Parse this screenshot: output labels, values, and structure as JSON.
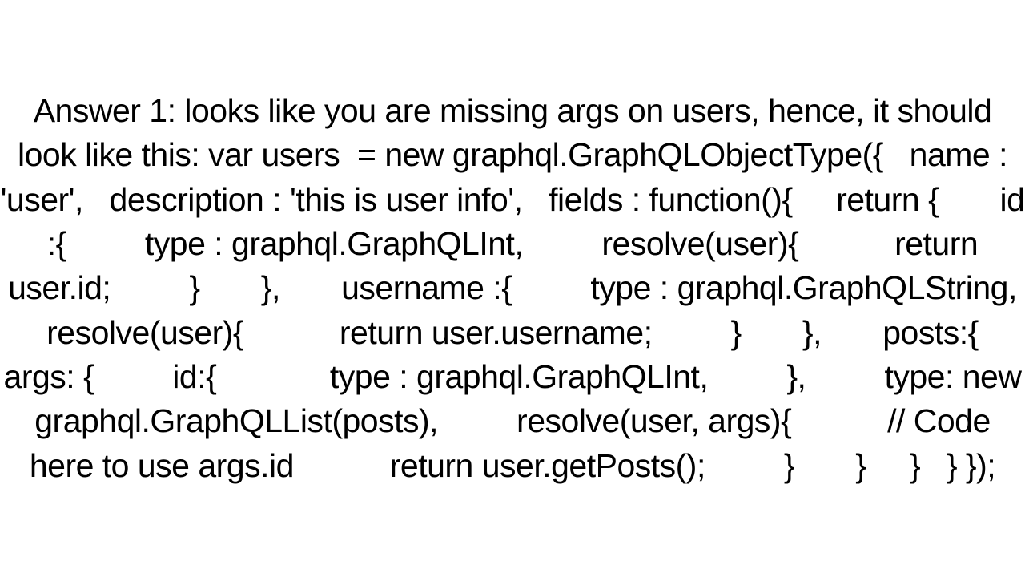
{
  "answer": {
    "text": "Answer 1: looks like you are missing args on users, hence, it should look like this: var users  = new graphql.GraphQLObjectType({   name : 'user',   description : 'this is user info',   fields : function(){     return {       id :{         type : graphql.GraphQLInt,         resolve(user){           return user.id;         }       },       username :{         type : graphql.GraphQLString,         resolve(user){           return user.username;         }       },       posts:{         args: {         id:{             type : graphql.GraphQLInt,         },         type: new graphql.GraphQLList(posts),         resolve(user, args){           // Code here to use args.id           return user.getPosts();         }       }     }   } });"
  }
}
